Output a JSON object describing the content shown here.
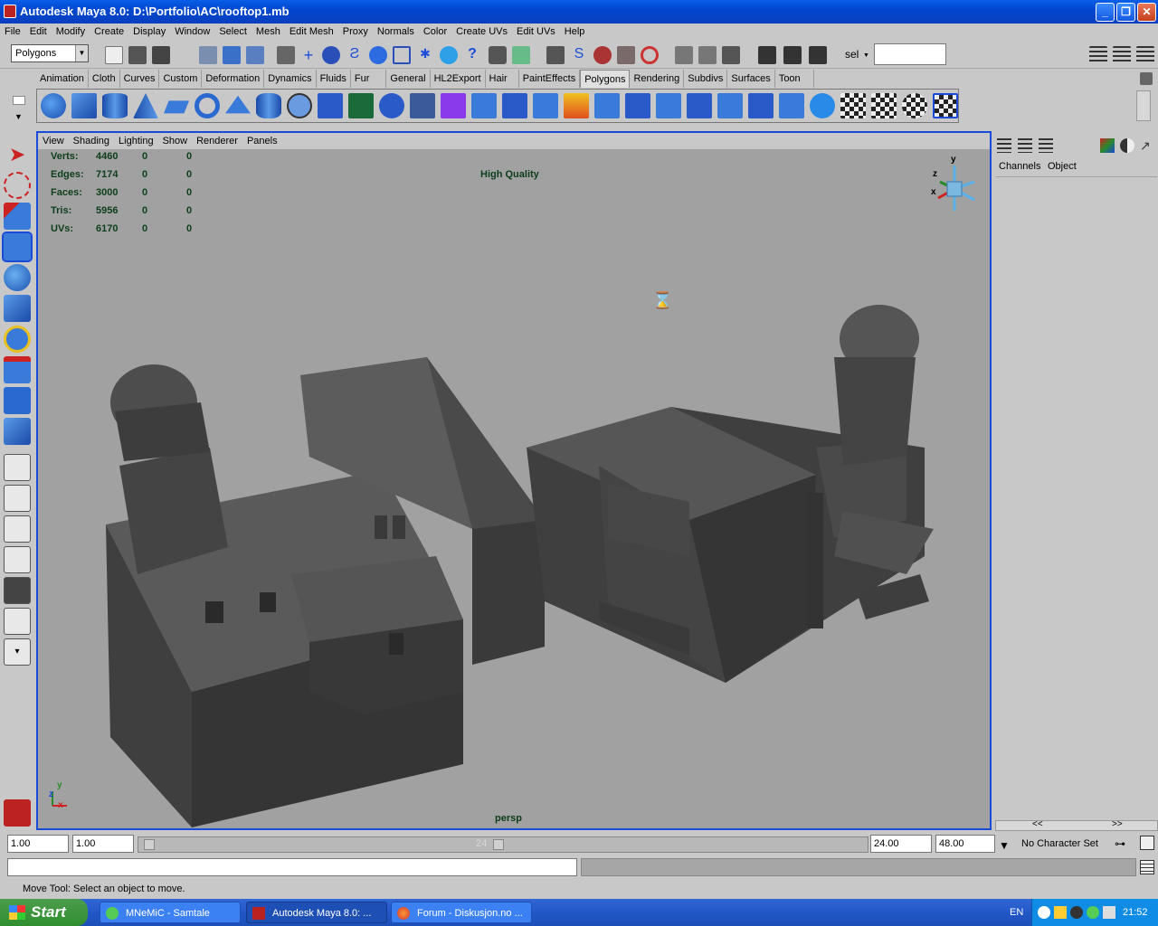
{
  "window": {
    "title": "Autodesk Maya 8.0: D:\\Portfolio\\AC\\rooftop1.mb"
  },
  "menubar": [
    "File",
    "Edit",
    "Modify",
    "Create",
    "Display",
    "Window",
    "Select",
    "Mesh",
    "Edit Mesh",
    "Proxy",
    "Normals",
    "Color",
    "Create UVs",
    "Edit UVs",
    "Help"
  ],
  "statusline": {
    "menu_set": "Polygons",
    "sel_label": "sel"
  },
  "shelf_tabs": [
    "Animation",
    "Cloth",
    "Curves",
    "Custom",
    "Deformation",
    "Dynamics",
    "Fluids",
    "Fur",
    "General",
    "HL2Export",
    "Hair",
    "PaintEffects",
    "Polygons",
    "Rendering",
    "Subdivs",
    "Surfaces",
    "Toon"
  ],
  "shelf_active": "Polygons",
  "panel_menu": [
    "View",
    "Shading",
    "Lighting",
    "Show",
    "Renderer",
    "Panels"
  ],
  "hud": {
    "rows": [
      {
        "label": "Verts:",
        "v1": "4460",
        "v2": "0",
        "v3": "0"
      },
      {
        "label": "Edges:",
        "v1": "7174",
        "v2": "0",
        "v3": "0"
      },
      {
        "label": "Faces:",
        "v1": "3000",
        "v2": "0",
        "v3": "0"
      },
      {
        "label": "Tris:",
        "v1": "5956",
        "v2": "0",
        "v3": "0"
      },
      {
        "label": "UVs:",
        "v1": "6170",
        "v2": "0",
        "v3": "0"
      }
    ],
    "quality": "High Quality",
    "camera": "persp",
    "axis_y": "y",
    "axis_z": "z",
    "axis_x": "x"
  },
  "channelbox": {
    "tabs": [
      "Channels",
      "Object"
    ],
    "arrows": [
      "<<",
      ">>"
    ]
  },
  "time": {
    "start": "1.00",
    "current": "1.00",
    "slider_label": "24",
    "end_playback": "24.00",
    "end_anim": "48.00",
    "character_set": "No Character Set"
  },
  "helpline": "Move Tool: Select an object to move.",
  "taskbar": {
    "start": "Start",
    "tasks": [
      "MNeMiC - Samtale",
      "Autodesk Maya 8.0: ...",
      "Forum - Diskusjon.no ..."
    ],
    "lang": "EN",
    "clock": "21:52"
  },
  "colors": {
    "viewport_bg": "#a1a1a1",
    "viewport_border": "#1a4ad8",
    "hud_text": "#0d3d1b",
    "ui_gray": "#c8c8c8"
  }
}
